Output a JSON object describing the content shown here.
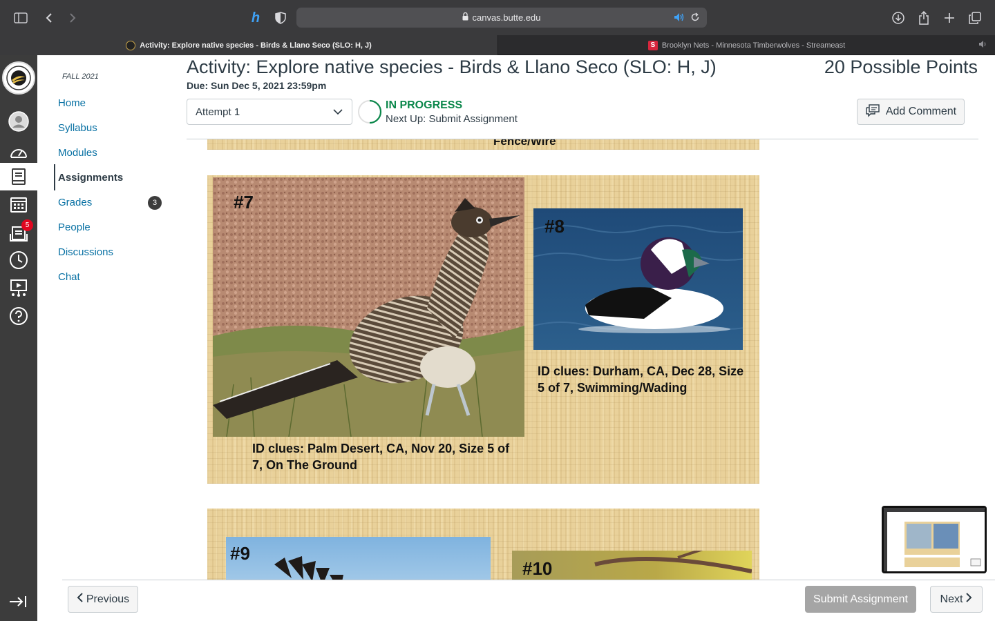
{
  "browser": {
    "url": "canvas.butte.edu",
    "tabs": [
      {
        "title": "Activity: Explore native species - Birds & Llano Seco (SLO: H, J)"
      },
      {
        "title": "Brooklyn Nets - Minnesota Timberwolves - Streameast"
      }
    ],
    "icons": [
      "sidebar-icon",
      "back-icon",
      "forward-icon",
      "hypothesis-icon",
      "shield-icon",
      "audio-icon",
      "reload-icon",
      "download-icon",
      "share-icon",
      "new-tab-icon",
      "tabs-overview-icon"
    ]
  },
  "global_nav": {
    "inbox_badge": "5",
    "items": [
      "account",
      "dashboard",
      "courses",
      "calendar",
      "inbox",
      "history",
      "studio",
      "help"
    ]
  },
  "course_nav": {
    "term": "FALL 2021",
    "items": [
      {
        "label": "Home"
      },
      {
        "label": "Syllabus"
      },
      {
        "label": "Modules"
      },
      {
        "label": "Assignments"
      },
      {
        "label": "Grades"
      },
      {
        "label": "People"
      },
      {
        "label": "Discussions"
      },
      {
        "label": "Chat"
      }
    ],
    "grades_badge": "3"
  },
  "header": {
    "title": "Activity: Explore native species - Birds & Llano Seco (SLO: H, J)",
    "points": "20 Possible Points",
    "due": "Due: Sun Dec 5, 2021 23:59pm",
    "attempt": "Attempt 1",
    "status": "IN PROGRESS",
    "next_up": "Next Up: Submit Assignment",
    "add_comment": "Add Comment"
  },
  "content": {
    "prev_slide_text": "Fence/Wire",
    "slide": {
      "bird7": {
        "num": "#7",
        "clue": "ID clues: Palm Desert, CA, Nov 20, Size 5 of 7, On The Ground"
      },
      "bird8": {
        "num": "#8",
        "clue": "ID clues: Durham, CA, Dec 28, Size 5 of 7, Swimming/Wading"
      }
    },
    "next_slide": {
      "bird9": {
        "num": "#9"
      },
      "bird10": {
        "num": "#10"
      }
    }
  },
  "footer": {
    "previous": "Previous",
    "submit": "Submit Assignment",
    "next": "Next"
  },
  "colors": {
    "link": "#0770a3",
    "text": "#2d3b45",
    "status_green": "#0b874b",
    "nav_bg": "#3c3c3c",
    "badge_red": "#e0061f"
  }
}
